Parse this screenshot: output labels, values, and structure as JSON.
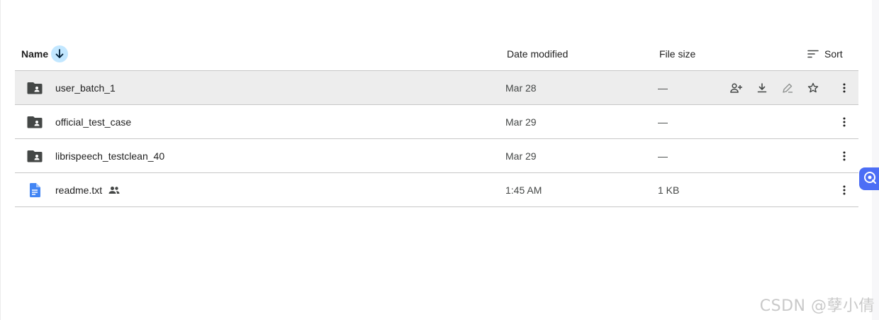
{
  "header": {
    "name_label": "Name",
    "date_label": "Date modified",
    "size_label": "File size",
    "sort_label": "Sort"
  },
  "rows": [
    {
      "name": "user_batch_1",
      "date": "Mar 28",
      "size": "—",
      "type": "shared-folder",
      "selected": true
    },
    {
      "name": "official_test_case",
      "date": "Mar 29",
      "size": "—",
      "type": "shared-folder"
    },
    {
      "name": "librispeech_testclean_40",
      "date": "Mar 29",
      "size": "—",
      "type": "shared-folder"
    },
    {
      "name": "readme.txt",
      "date": "1:45 AM",
      "size": "1 KB",
      "type": "doc",
      "shared": true
    }
  ],
  "row_actions": [
    "share-icon",
    "download-icon",
    "rename-icon",
    "star-icon",
    "more-vert-icon"
  ],
  "colors": {
    "accent": "#c2e7ff",
    "selected_row": "#ededed",
    "doc_blue": "#4285f4",
    "float_button": "#4c6ef5"
  },
  "watermark": "CSDN @孽小倩"
}
